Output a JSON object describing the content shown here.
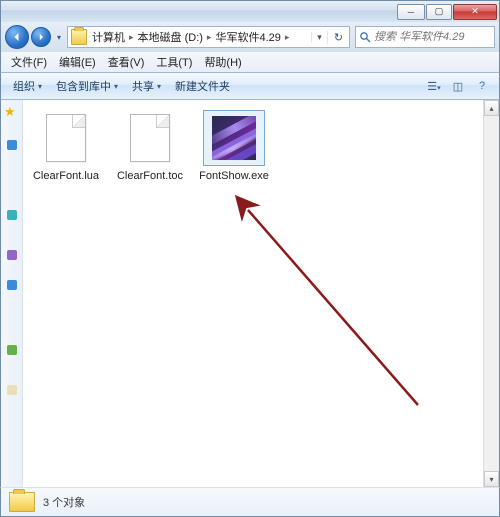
{
  "titlebar": {
    "min_icon": "minimize-icon",
    "max_icon": "maximize-icon",
    "close_icon": "close-icon"
  },
  "nav": {
    "back_icon": "arrow-left-icon",
    "fwd_icon": "arrow-right-icon"
  },
  "breadcrumb": {
    "items": [
      "计算机",
      "本地磁盘 (D:)",
      "华军软件4.29"
    ]
  },
  "address_dropdown_icon": "chevron-down-icon",
  "address_refresh_icon": "refresh-icon",
  "search": {
    "placeholder": "搜索 华军软件4.29",
    "icon": "search-icon"
  },
  "menu": {
    "items": [
      "文件(F)",
      "编辑(E)",
      "查看(V)",
      "工具(T)",
      "帮助(H)"
    ]
  },
  "cmdbar": {
    "organize": "组织",
    "include": "包含到库中",
    "share": "共享",
    "newfolder": "新建文件夹",
    "view_icon": "view-options-icon",
    "preview_icon": "preview-pane-icon",
    "help_icon": "help-icon"
  },
  "files": [
    {
      "name": "ClearFont.lua",
      "type": "document",
      "selected": false
    },
    {
      "name": "ClearFont.toc",
      "type": "document",
      "selected": false
    },
    {
      "name": "FontShow.exe",
      "type": "exe",
      "selected": true
    }
  ],
  "status": {
    "text": "3 个对象"
  },
  "annotation": {
    "color": "#8b1a1a"
  }
}
